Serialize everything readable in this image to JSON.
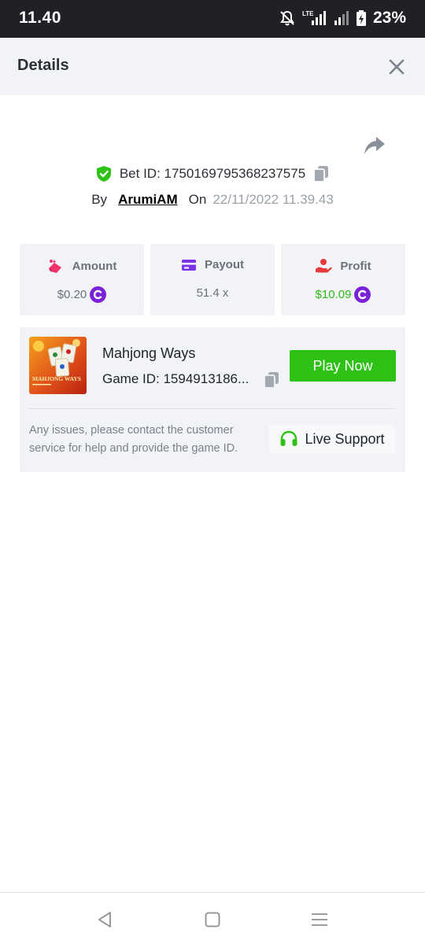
{
  "status_bar": {
    "time": "11.40",
    "battery": "23%",
    "network": "LTE",
    "icons": [
      "mute-icon",
      "lte-signal-icon",
      "signal-icon",
      "battery-icon"
    ]
  },
  "header": {
    "title": "Details",
    "close_icon": "close-icon"
  },
  "bet": {
    "id_text": "Bet ID: 1750169795368237575",
    "by_label": "By",
    "username": "ArumiAM",
    "on_label": "On",
    "datetime": "22/11/2022 11.39.43"
  },
  "stats": {
    "amount": {
      "label": "Amount",
      "value": "$0.20",
      "icon": "bet-amount-icon"
    },
    "payout": {
      "label": "Payout",
      "value": "51.4 x",
      "icon": "card-icon"
    },
    "profit": {
      "label": "Profit",
      "value": "$10.09",
      "icon": "profit-hand-icon"
    }
  },
  "game": {
    "name": "Mahjong Ways",
    "game_id": "Game ID: 1594913186...",
    "play_label": "Play Now",
    "help_text": "Any issues, please contact the customer service for help and provide the game ID.",
    "support_label": "Live Support",
    "thumb_text": "MAHJONG WAYS"
  },
  "colors": {
    "accent_green": "#2fc216",
    "profit_green": "#2eb816",
    "coin_purple": "#7a22d8",
    "panel_bg": "#f2f3f7"
  }
}
